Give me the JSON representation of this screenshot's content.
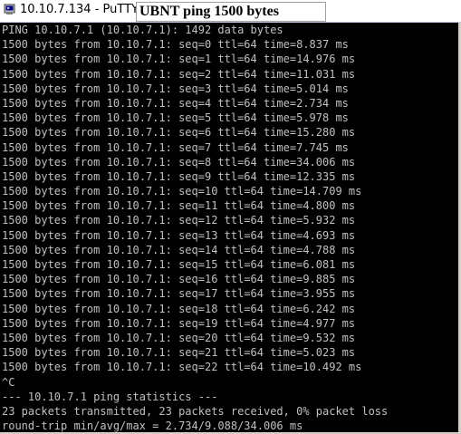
{
  "window": {
    "title": "10.10.7.134 - PuTTY",
    "app_icon": "putty-terminal-icon"
  },
  "overlay_label": "UBNT ping 1500 bytes",
  "terminal": {
    "colors": {
      "background": "#000000",
      "foreground": "#c0c0c0"
    },
    "lines": [
      "PING 10.10.7.1 (10.10.7.1): 1492 data bytes",
      "1500 bytes from 10.10.7.1: seq=0 ttl=64 time=8.837 ms",
      "1500 bytes from 10.10.7.1: seq=1 ttl=64 time=14.976 ms",
      "1500 bytes from 10.10.7.1: seq=2 ttl=64 time=11.031 ms",
      "1500 bytes from 10.10.7.1: seq=3 ttl=64 time=5.014 ms",
      "1500 bytes from 10.10.7.1: seq=4 ttl=64 time=2.734 ms",
      "1500 bytes from 10.10.7.1: seq=5 ttl=64 time=5.978 ms",
      "1500 bytes from 10.10.7.1: seq=6 ttl=64 time=15.280 ms",
      "1500 bytes from 10.10.7.1: seq=7 ttl=64 time=7.745 ms",
      "1500 bytes from 10.10.7.1: seq=8 ttl=64 time=34.006 ms",
      "1500 bytes from 10.10.7.1: seq=9 ttl=64 time=12.335 ms",
      "1500 bytes from 10.10.7.1: seq=10 ttl=64 time=14.709 ms",
      "1500 bytes from 10.10.7.1: seq=11 ttl=64 time=4.800 ms",
      "1500 bytes from 10.10.7.1: seq=12 ttl=64 time=5.932 ms",
      "1500 bytes from 10.10.7.1: seq=13 ttl=64 time=4.693 ms",
      "1500 bytes from 10.10.7.1: seq=14 ttl=64 time=4.788 ms",
      "1500 bytes from 10.10.7.1: seq=15 ttl=64 time=6.081 ms",
      "1500 bytes from 10.10.7.1: seq=16 ttl=64 time=9.885 ms",
      "1500 bytes from 10.10.7.1: seq=17 ttl=64 time=3.955 ms",
      "1500 bytes from 10.10.7.1: seq=18 ttl=64 time=6.242 ms",
      "1500 bytes from 10.10.7.1: seq=19 ttl=64 time=4.977 ms",
      "1500 bytes from 10.10.7.1: seq=20 ttl=64 time=9.532 ms",
      "1500 bytes from 10.10.7.1: seq=21 ttl=64 time=5.023 ms",
      "1500 bytes from 10.10.7.1: seq=22 ttl=64 time=10.492 ms",
      "^C",
      "--- 10.10.7.1 ping statistics ---",
      "23 packets transmitted, 23 packets received, 0% packet loss",
      "round-trip min/avg/max = 2.734/9.088/34.006 ms"
    ]
  }
}
